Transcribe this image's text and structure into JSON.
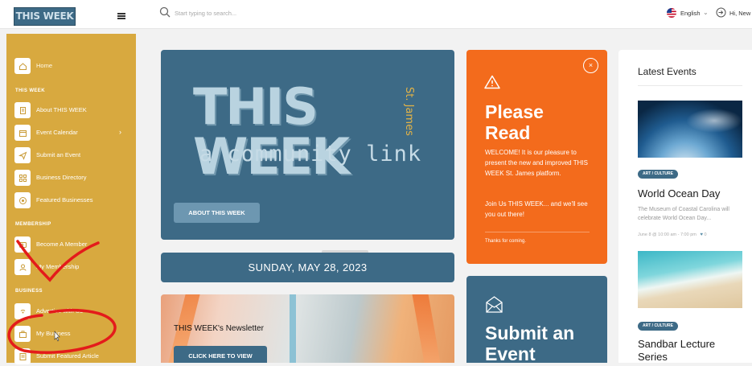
{
  "topbar": {
    "logo_text": "THIS WEEK",
    "search_placeholder": "Start typing to search...",
    "language": "English",
    "greeting": "Hi, New"
  },
  "sidebar": {
    "home": "Home",
    "section_this_week": "THIS WEEK",
    "about": "About THIS WEEK",
    "calendar": "Event Calendar",
    "submit_event": "Submit an Event",
    "directory": "Business Directory",
    "featured": "Featured Businesses",
    "section_membership": "MEMBERSHIP",
    "become_member": "Become A Member",
    "my_membership": "My Membership",
    "section_business": "BUSINESS",
    "advertise": "Advertise with Us",
    "my_business": "My Business",
    "submit_article": "Submit Featured Article",
    "color": "#d8a93f"
  },
  "hero": {
    "title": "THIS WEEK",
    "tagline": "St. James",
    "subtitle": "a community link",
    "button": "ABOUT THIS WEEK",
    "color": "#3d6a86"
  },
  "date_bar": "SUNDAY, MAY 28, 2023",
  "newsletter": {
    "title": "THIS WEEK's Newsletter",
    "button": "CLICK HERE TO VIEW"
  },
  "please_read": {
    "title": "Please Read",
    "close": "×",
    "body1": "WELCOME! It is our pleasure to present the new and improved THIS WEEK St. James platform.",
    "body2": "Join Us THIS WEEK... and we'll see you out there!",
    "footer": "Thanks for coming.",
    "color": "#f36b1c"
  },
  "submit_card": {
    "title": "Submit an Event"
  },
  "latest_events": {
    "heading": "Latest Events",
    "events": [
      {
        "category": "ART / CULTURE",
        "name": "World Ocean Day",
        "description": "The Museum of Coastal Carolina will celebrate World Ocean Day...",
        "meta": "June 8 @ 10:00 am - 7:00 pm",
        "likes": "0"
      },
      {
        "category": "ART / CULTURE",
        "name": "Sandbar Lecture Series"
      }
    ]
  }
}
